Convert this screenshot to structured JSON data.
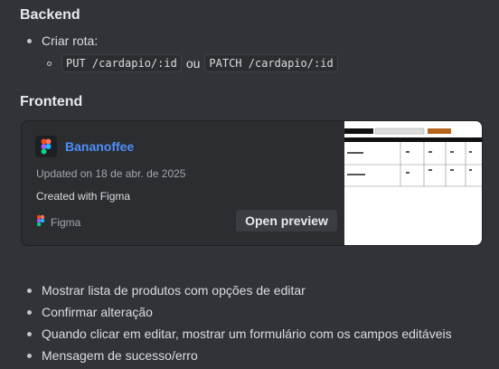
{
  "backend": {
    "heading": "Backend",
    "item_label": "Criar rota:",
    "route_put": "PUT /cardapio/:id",
    "route_join": "ou",
    "route_patch": "PATCH /cardapio/:id"
  },
  "frontend": {
    "heading": "Frontend"
  },
  "embed": {
    "title": "Bananoffee",
    "updated": "Updated on 18 de abr. de 2025",
    "created": "Created with Figma",
    "brand": "Figma",
    "preview_button": "Open preview",
    "accent_color": "#4d8ef7"
  },
  "tasks": [
    "Mostrar lista de produtos com opções de editar",
    "Confirmar alteração",
    "Quando clicar em editar, mostrar um formulário com os campos editáveis",
    "Mensagem de sucesso/erro"
  ]
}
